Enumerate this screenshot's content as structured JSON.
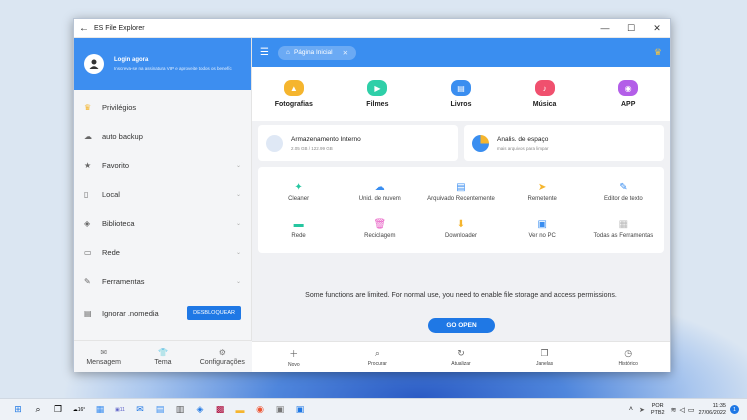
{
  "window": {
    "title": "ES File Explorer"
  },
  "sidebar": {
    "login_title": "Login agora",
    "login_subtitle": "Inscreva-se na assinatura VIP e aproveite todos os benefíc",
    "items": [
      {
        "label": "Privilégios",
        "icon": "crown-icon"
      },
      {
        "label": "auto backup",
        "icon": "cloud-icon"
      },
      {
        "label": "Favorito",
        "icon": "star-icon"
      },
      {
        "label": "Local",
        "icon": "phone-icon"
      },
      {
        "label": "Biblioteca",
        "icon": "library-icon"
      },
      {
        "label": "Rede",
        "icon": "network-icon"
      },
      {
        "label": "Ferramentas",
        "icon": "wrench-icon"
      },
      {
        "label": "Ignorar .nomedia",
        "icon": "file-icon",
        "button": "DESBLOQUEAR"
      }
    ],
    "bottom": [
      {
        "label": "Mensagem",
        "icon": "mail-icon"
      },
      {
        "label": "Tema",
        "icon": "shirt-icon"
      },
      {
        "label": "Configurações",
        "icon": "gear-icon"
      }
    ]
  },
  "main": {
    "breadcrumb": "Página Inicial",
    "categories": [
      {
        "label": "Fotografias",
        "color": "#f5b52e"
      },
      {
        "label": "Filmes",
        "color": "#2fcfa8"
      },
      {
        "label": "Livros",
        "color": "#3a8ef0"
      },
      {
        "label": "Música",
        "color": "#f0506e"
      },
      {
        "label": "APP",
        "color": "#b35ee8"
      }
    ],
    "storage": {
      "name": "Armazenamento Interno",
      "usage": "2.05 GB / 122.99 GB",
      "analysis_name": "Analis. de espaço",
      "analysis_sub": "mais arquivos para limpar"
    },
    "tools": [
      {
        "label": "Cleaner",
        "color": "#26c6a0"
      },
      {
        "label": "Unid. de nuvem",
        "color": "#3a8ef0"
      },
      {
        "label": "Arquivado Recentemente",
        "color": "#3a8ef0"
      },
      {
        "label": "Remetente",
        "color": "#f5b52e"
      },
      {
        "label": "Editor de texto",
        "color": "#3a8ef0"
      },
      {
        "label": "Rede",
        "color": "#26c6a0"
      },
      {
        "label": "Reciclagem",
        "color": "#e85ec4"
      },
      {
        "label": "Downloader",
        "color": "#f5b52e"
      },
      {
        "label": "Ver no PC",
        "color": "#3a8ef0"
      },
      {
        "label": "Todas as Ferramentas",
        "color": "#bbbbbb"
      }
    ],
    "notice": "Some functions are limited. For normal use, you need to enable file storage and access permissions.",
    "go_open": "GO OPEN",
    "bottom": [
      {
        "label": "Novo"
      },
      {
        "label": "Procurar"
      },
      {
        "label": "Atualizar"
      },
      {
        "label": "Janelas"
      },
      {
        "label": "Histórico"
      }
    ]
  },
  "taskbar": {
    "weather": "16°",
    "mail_badge": "11",
    "lang_line1": "POR",
    "lang_line2": "PTB2",
    "time": "11:35",
    "date": "27/06/2022",
    "notif_count": "1"
  }
}
